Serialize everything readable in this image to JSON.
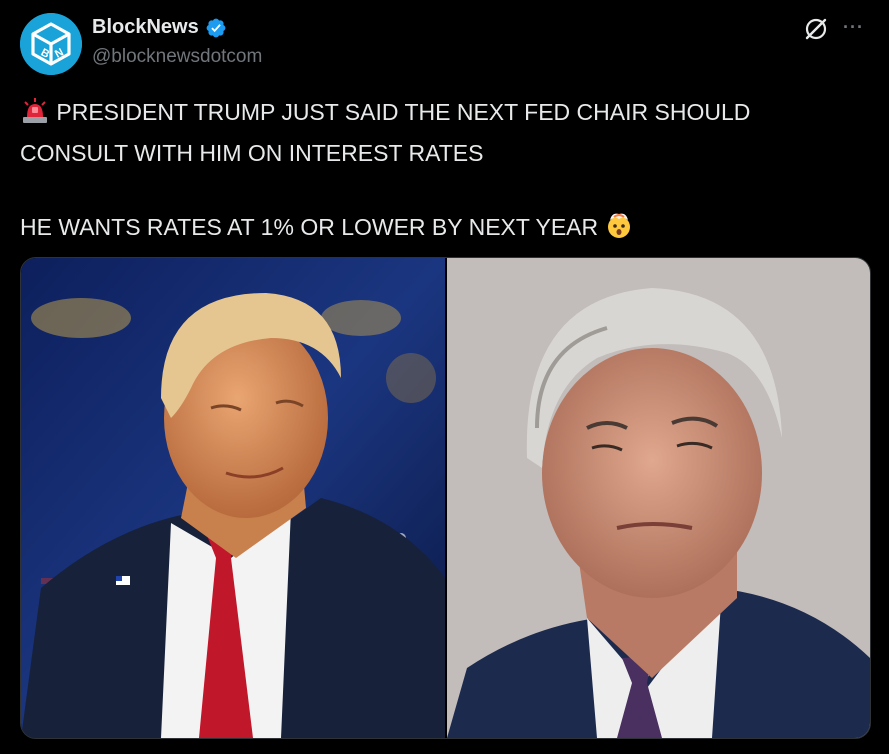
{
  "tweet": {
    "display_name": "BlockNews",
    "handle": "@blocknewsdotcom",
    "verified": true,
    "text_line1": "PRESIDENT TRUMP JUST SAID THE NEXT FED CHAIR SHOULD CONSULT WITH HIM ON INTEREST RATES",
    "text_line2": "HE WANTS RATES AT 1% OR LOWER BY NEXT YEAR",
    "leading_emoji": "rotating-light-emoji",
    "trailing_emoji": "exploding-head-emoji",
    "media": [
      {
        "name": "photo-trump",
        "icon": "person-photo"
      },
      {
        "name": "photo-powell",
        "icon": "person-photo"
      }
    ]
  },
  "colors": {
    "background": "#000000",
    "text": "#e7e9ea",
    "secondary_text": "#71767b",
    "verified_badge": "#1d9bf0",
    "avatar": "#1aa3d8"
  },
  "icons": {
    "grok": "grok-slash-icon",
    "more": "more-horizontal-icon",
    "verified": "verified-badge-icon"
  }
}
